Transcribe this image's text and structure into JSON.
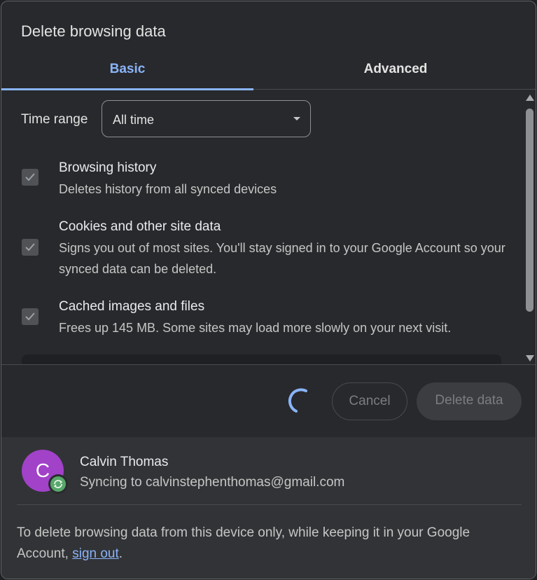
{
  "dialog": {
    "title": "Delete browsing data"
  },
  "tabs": [
    {
      "label": "Basic",
      "selected": true
    },
    {
      "label": "Advanced",
      "selected": false
    }
  ],
  "time_range": {
    "label": "Time range",
    "value": "All time"
  },
  "options": [
    {
      "title": "Browsing history",
      "description": "Deletes history from all synced devices",
      "checked": true
    },
    {
      "title": "Cookies and other site data",
      "description": "Signs you out of most sites. You'll stay signed in to your Google Account so your synced data can be deleted.",
      "checked": true
    },
    {
      "title": "Cached images and files",
      "description": "Frees up 145 MB. Some sites may load more slowly on your next visit.",
      "checked": true
    }
  ],
  "actions": {
    "cancel_label": "Cancel",
    "delete_label": "Delete data"
  },
  "account": {
    "avatar_letter": "C",
    "name": "Calvin Thomas",
    "sync_prefix": "Syncing to ",
    "email": "calvinstephenthomas@gmail.com"
  },
  "footer_note": {
    "text": "To delete browsing data from this device only, while keeping it in your Google Account, ",
    "link": "sign out",
    "suffix": "."
  },
  "colors": {
    "accent": "#8ab4f8",
    "avatar": "#a142c9",
    "sync": "#57a86a"
  }
}
